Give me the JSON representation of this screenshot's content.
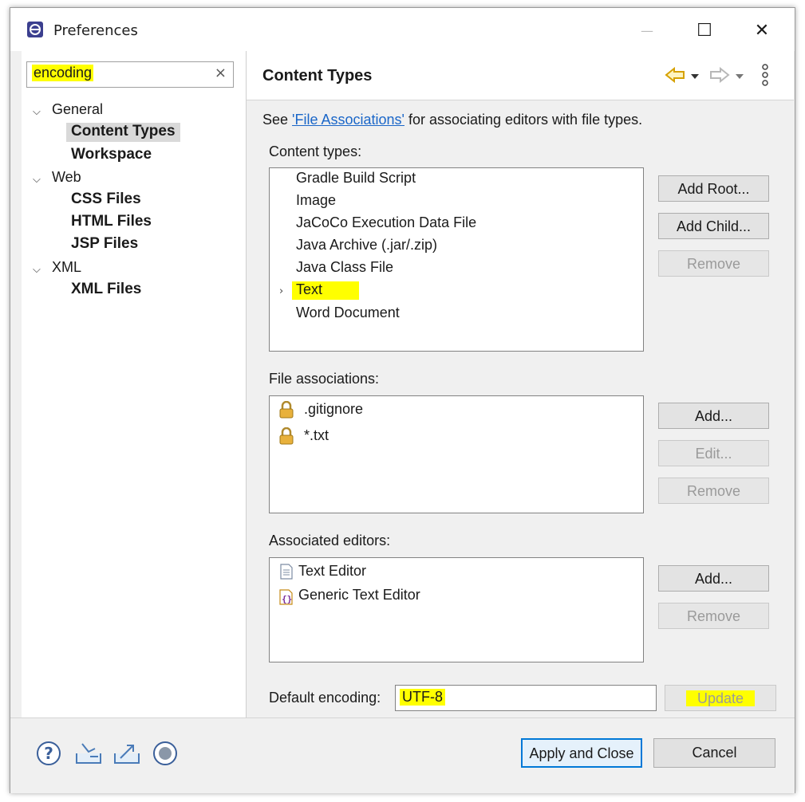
{
  "window": {
    "title": "Preferences",
    "minimize_glyph": "—",
    "maximize_glyph": "☐",
    "close_glyph": "✕"
  },
  "filter": {
    "value": "encoding",
    "clear_glyph": "×",
    "highlight_color": "#ffff00"
  },
  "tree": {
    "general": "General",
    "content_types": "Content Types",
    "workspace": "Workspace",
    "web": "Web",
    "css_files": "CSS Files",
    "html_files": "HTML Files",
    "jsp_files": "JSP Files",
    "xml": "XML",
    "xml_files": "XML Files"
  },
  "page": {
    "title": "Content Types",
    "see_prefix": "See ",
    "see_link": "'File Associations'",
    "see_suffix": " for associating editors with file types.",
    "content_types_label": "Content types:",
    "file_assoc_label": "File associations:",
    "assoc_editors_label": "Associated editors:",
    "default_encoding_label": "Default encoding:",
    "default_encoding_value": "UTF-8"
  },
  "content_types": [
    "Gradle Build Script",
    "Image",
    "JaCoCo Execution Data File",
    "Java Archive (.jar/.zip)",
    "Java Class File",
    "Text",
    "Word Document"
  ],
  "file_associations": [
    ".gitignore",
    "*.txt"
  ],
  "associated_editors": [
    "Text Editor",
    "Generic Text Editor"
  ],
  "buttons": {
    "add_root": "Add Root...",
    "add_child": "Add Child...",
    "remove_ct": "Remove",
    "add_fa": "Add...",
    "edit_fa": "Edit...",
    "remove_fa": "Remove",
    "add_ed": "Add...",
    "remove_ed": "Remove",
    "update": "Update",
    "apply_close": "Apply and Close",
    "cancel": "Cancel"
  },
  "colors": {
    "link": "#1a66c8",
    "accent": "#0078d7"
  }
}
